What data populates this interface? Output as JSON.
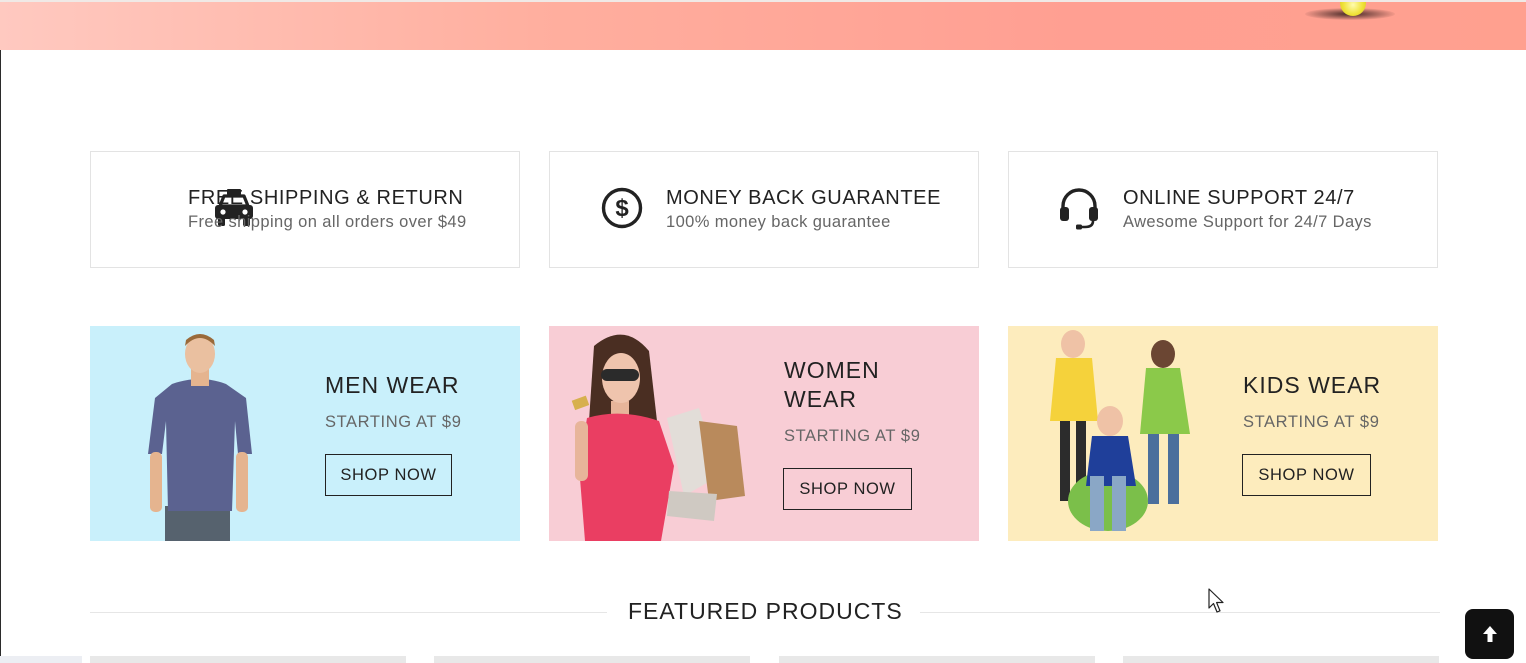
{
  "hero": {
    "icon": "ball-icon"
  },
  "features": [
    {
      "icon": "car-icon",
      "title": "FREE SHIPPING & RETURN",
      "subtitle": "Free shipping on all orders over $49"
    },
    {
      "icon": "dollar-circle-icon",
      "title": "MONEY BACK GUARANTEE",
      "subtitle": "100% money back guarantee"
    },
    {
      "icon": "headset-icon",
      "title": "ONLINE SUPPORT 24/7",
      "subtitle": "Awesome Support for 24/7 Days"
    }
  ],
  "banners": [
    {
      "title": "MEN WEAR",
      "price": "STARTING AT $9",
      "button": "SHOP NOW",
      "bg": "#c9f0fb"
    },
    {
      "title": "WOMEN WEAR",
      "price": "STARTING AT $9",
      "button": "SHOP NOW",
      "bg": "#f8cdd5"
    },
    {
      "title": "KIDS WEAR",
      "price": "STARTING AT $9",
      "button": "SHOP NOW",
      "bg": "#fdecbd"
    }
  ],
  "featured": {
    "title": "FEATURED PRODUCTS"
  },
  "scroll_top": {
    "icon": "arrow-up-icon"
  }
}
